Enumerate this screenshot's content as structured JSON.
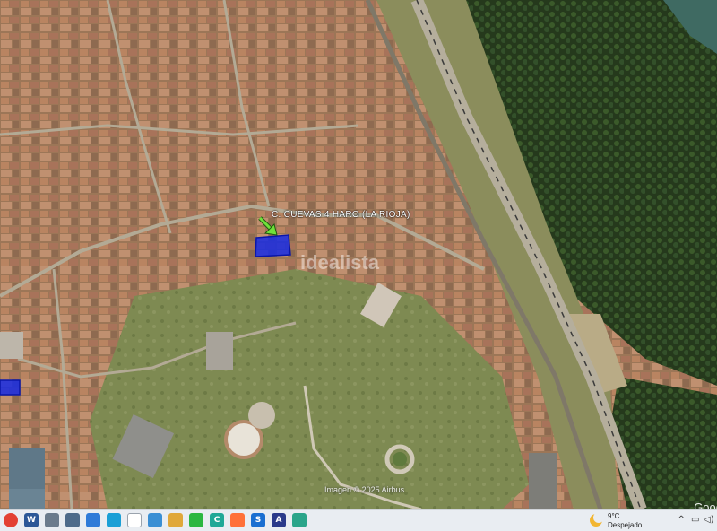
{
  "map": {
    "placemark_label": "C. CUEVAS 4 HARO (LA RIOJA)",
    "watermark_text": "idealista",
    "imagery_credit": "Imagen © 2025 Airbus",
    "corner_brand": "Goog",
    "colors": {
      "highlight_fill": "#1a2ee0",
      "highlight_stroke": "#0a16a8",
      "arrow": "#6fe03a",
      "roof": "#b5805e",
      "vegetation": "#2f4a22",
      "grass": "#7d8a50",
      "road": "#a9a392",
      "river": "#3f6a62"
    }
  },
  "taskbar": {
    "icons": [
      {
        "name": "chrome-icon",
        "glyph": "",
        "color": "#e34133"
      },
      {
        "name": "word-icon",
        "glyph": "W",
        "color": "#2b5797"
      },
      {
        "name": "app-window-icon",
        "glyph": "",
        "color": "#6b7b8c"
      },
      {
        "name": "network-icon",
        "glyph": "",
        "color": "#4e6b8a"
      },
      {
        "name": "gallery-icon",
        "glyph": "",
        "color": "#2f7bd8"
      },
      {
        "name": "edge-icon",
        "glyph": "",
        "color": "#1a9fd6"
      },
      {
        "name": "file-icon",
        "glyph": "",
        "color": "#ffffff"
      },
      {
        "name": "browser-icon",
        "glyph": "",
        "color": "#3a8fd4"
      },
      {
        "name": "folder-icon",
        "glyph": "",
        "color": "#e0a83a"
      },
      {
        "name": "whatsapp-icon",
        "glyph": "",
        "color": "#2bb741"
      },
      {
        "name": "chat-icon",
        "glyph": "C",
        "color": "#1fa897"
      },
      {
        "name": "firefox-icon",
        "glyph": "",
        "color": "#ff7139"
      },
      {
        "name": "s-app-icon",
        "glyph": "S",
        "color": "#1a6fd1"
      },
      {
        "name": "arc-icon",
        "glyph": "A",
        "color": "#2a3a8a"
      },
      {
        "name": "monitor-icon",
        "glyph": "",
        "color": "#2aa58a"
      }
    ],
    "weather": {
      "temperature": "9°C",
      "condition": "Despejado"
    },
    "tray": {
      "chevron": "^",
      "display": "▭",
      "network": "▢",
      "volume": "◁)"
    }
  }
}
